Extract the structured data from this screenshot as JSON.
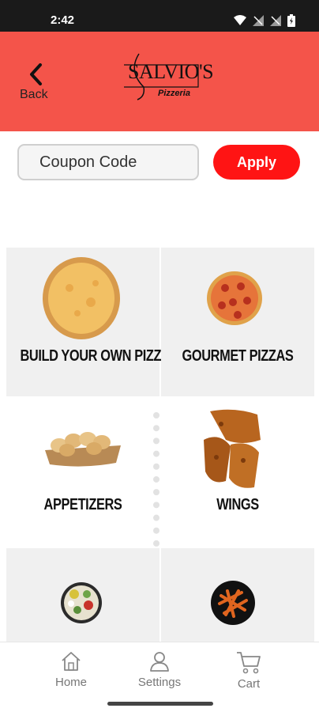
{
  "status_bar": {
    "time": "2:42"
  },
  "header": {
    "back_label": "Back",
    "logo_title": "SALVIO'S",
    "logo_subtitle": "Pizzeria"
  },
  "coupon": {
    "placeholder": "Coupon Code",
    "apply_label": "Apply"
  },
  "categories": [
    {
      "label": "BUILD YOUR OWN PIZZA",
      "icon": "cheese-pizza"
    },
    {
      "label": "GOURMET PIZZAS",
      "icon": "pepperoni-pizza"
    },
    {
      "label": "APPETIZERS",
      "icon": "garlic-knots-basket"
    },
    {
      "label": "WINGS",
      "icon": "chicken-wings"
    },
    {
      "label": "",
      "icon": "salad-bowl"
    },
    {
      "label": "",
      "icon": "pasta-bowl"
    }
  ],
  "nav": {
    "items": [
      {
        "label": "Home",
        "icon": "home-icon"
      },
      {
        "label": "Settings",
        "icon": "user-icon"
      },
      {
        "label": "Cart",
        "icon": "cart-icon"
      }
    ]
  },
  "colors": {
    "header_bg": "#f4544a",
    "apply_bg": "#ff1414",
    "status_bar_bg": "#1a1a1a"
  }
}
